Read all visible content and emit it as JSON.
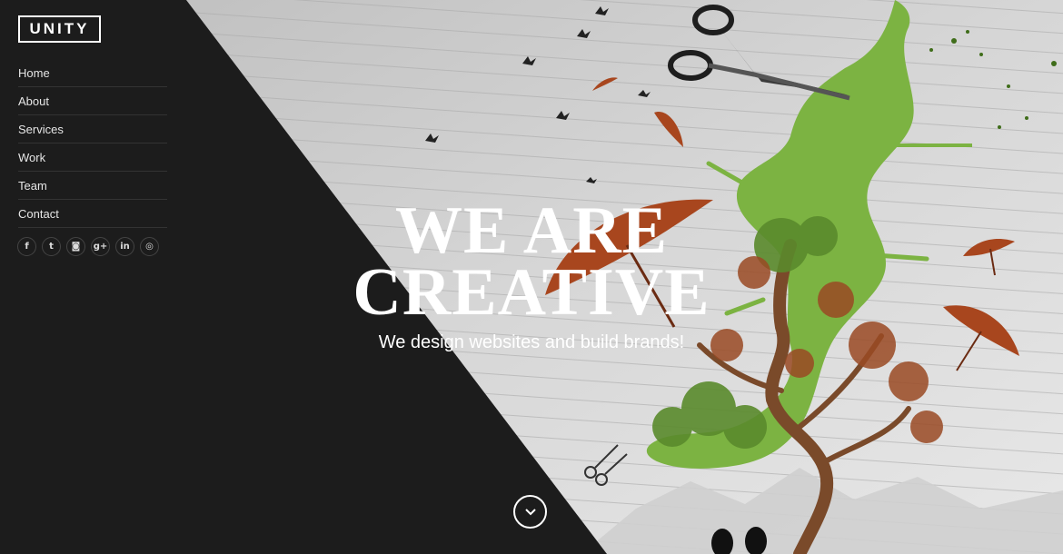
{
  "brand": {
    "logo_text": "UNITY"
  },
  "nav": {
    "items": [
      {
        "label": "Home"
      },
      {
        "label": "About"
      },
      {
        "label": "Services"
      },
      {
        "label": "Work"
      },
      {
        "label": "Team"
      },
      {
        "label": "Contact"
      }
    ]
  },
  "social": {
    "facebook": "f",
    "twitter": "t",
    "instagram": "◙",
    "google_plus": "g+",
    "linkedin": "in",
    "dribbble": "◎"
  },
  "hero": {
    "title_line1": "WE ARE",
    "title_line2": "CREATIVE",
    "subtitle": "We design websites and build brands!"
  },
  "colors": {
    "dark_panel": "#1c1c1c",
    "paint_green": "#7cb342",
    "umbrella_red": "#a8461e",
    "text": "#ffffff"
  },
  "icons": {
    "scroll_down": "chevron-down-icon"
  }
}
